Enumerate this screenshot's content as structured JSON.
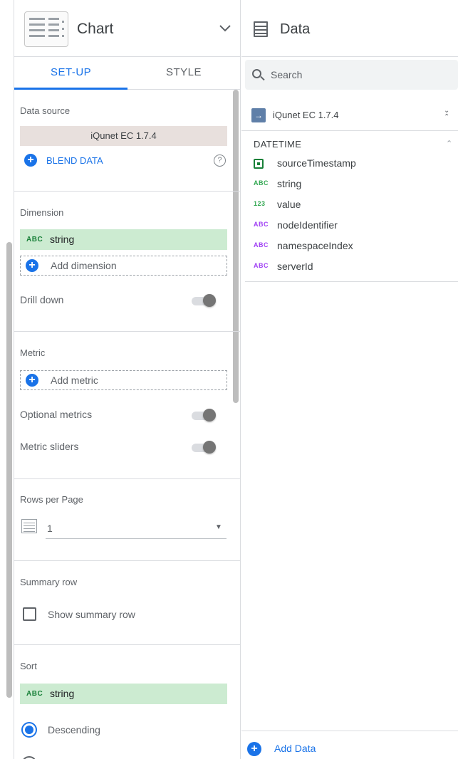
{
  "chart_panel": {
    "title": "Chart",
    "tabs": [
      {
        "label": "SET-UP",
        "active": true
      },
      {
        "label": "STYLE",
        "active": false
      }
    ],
    "data_source": {
      "label": "Data source",
      "value": "iQunet EC 1.7.4",
      "blend_label": "BLEND DATA",
      "help_icon": "?"
    },
    "dimension": {
      "label": "Dimension",
      "chip_type": "ABC",
      "chip_label": "string",
      "add_label": "Add dimension",
      "drill_down_label": "Drill down"
    },
    "metric": {
      "label": "Metric",
      "add_label": "Add metric",
      "optional_label": "Optional metrics",
      "sliders_label": "Metric sliders"
    },
    "rows_per_page": {
      "label": "Rows per Page",
      "value": "1"
    },
    "summary_row": {
      "label": "Summary row",
      "checkbox_label": "Show summary row"
    },
    "sort": {
      "label": "Sort",
      "chip_type": "ABC",
      "chip_label": "string",
      "descending_label": "Descending"
    }
  },
  "data_panel": {
    "title": "Data",
    "search_placeholder": "Search",
    "source_name": "iQunet EC 1.7.4",
    "group_label": "DATETIME",
    "fields": [
      {
        "type": "date",
        "icon": "calendar-icon",
        "label": "sourceTimestamp"
      },
      {
        "type": "ABC",
        "icon": "text-type-icon",
        "label": "string"
      },
      {
        "type": "123",
        "icon": "number-type-icon",
        "label": "value"
      },
      {
        "type": "ABC",
        "icon": "text-type-icon",
        "label": "nodeIdentifier"
      },
      {
        "type": "ABC",
        "icon": "text-type-icon",
        "label": "namespaceIndex"
      },
      {
        "type": "ABC",
        "icon": "text-type-icon",
        "label": "serverId"
      }
    ],
    "add_data_label": "Add Data"
  },
  "colors": {
    "accent": "#1a73e8",
    "dimension_chip": "#ccebd1",
    "source_box": "#e8e0dd",
    "dimension_type": "#34a853",
    "text_type_purple": "#a142f4"
  }
}
